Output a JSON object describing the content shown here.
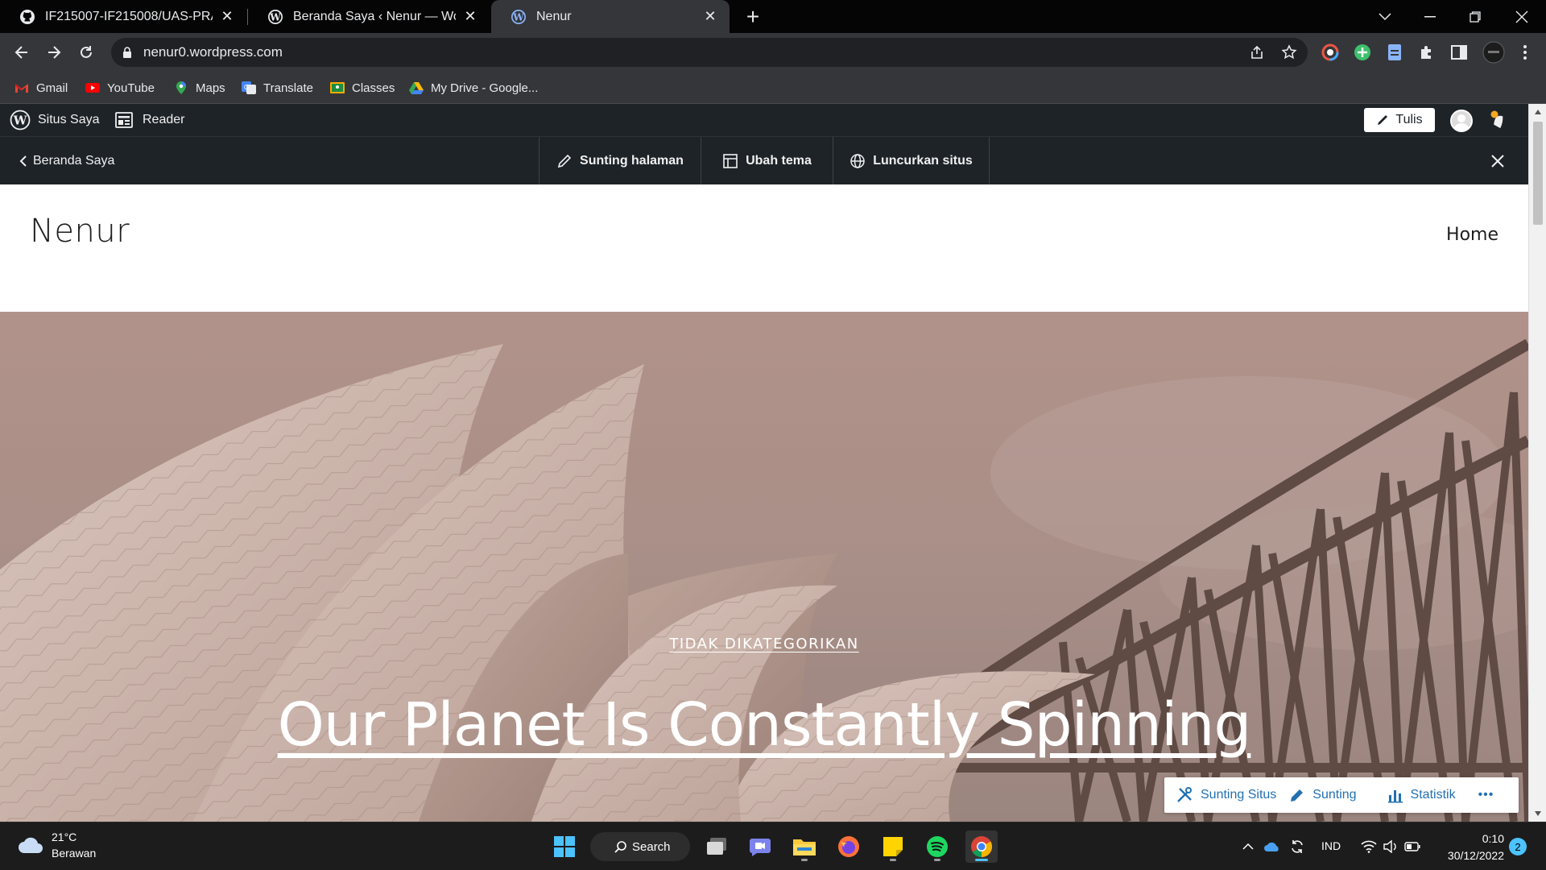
{
  "browser": {
    "tabs": [
      {
        "title": "IF215007-IF215008/UAS-PRAKTIKUM",
        "active": false
      },
      {
        "title": "Beranda Saya ‹ Nenur — WordPress.com",
        "active": false
      },
      {
        "title": "Nenur",
        "active": true
      }
    ],
    "url": "nenur0.wordpress.com",
    "bookmarks": [
      "Gmail",
      "YouTube",
      "Maps",
      "Translate",
      "Classes",
      "My Drive - Google..."
    ]
  },
  "wp_admin": {
    "my_sites": "Situs Saya",
    "reader": "Reader",
    "write": "Tulis"
  },
  "preview_bar": {
    "back": "Beranda Saya",
    "edit_page": "Sunting halaman",
    "change_theme": "Ubah tema",
    "launch_site": "Luncurkan situs"
  },
  "site": {
    "title": "Nenur",
    "nav": [
      "Home"
    ],
    "hero": {
      "category": "TIDAK DIKATEGORIKAN",
      "post_title": "Our Planet Is Constantly Spinning"
    }
  },
  "floating_toolbar": {
    "edit_site": "Sunting Situs",
    "edit": "Sunting",
    "stats": "Statistik",
    "more": "•••"
  },
  "taskbar": {
    "weather_temp": "21°C",
    "weather_desc": "Berawan",
    "search": "Search",
    "language": "IND",
    "time": "0:10",
    "date": "30/12/2022",
    "notifications": "2"
  },
  "colors": {
    "wp_admin_bg": "#1d2327",
    "chrome_toolbar": "#35363a",
    "wp_link_blue": "#2271b1"
  }
}
